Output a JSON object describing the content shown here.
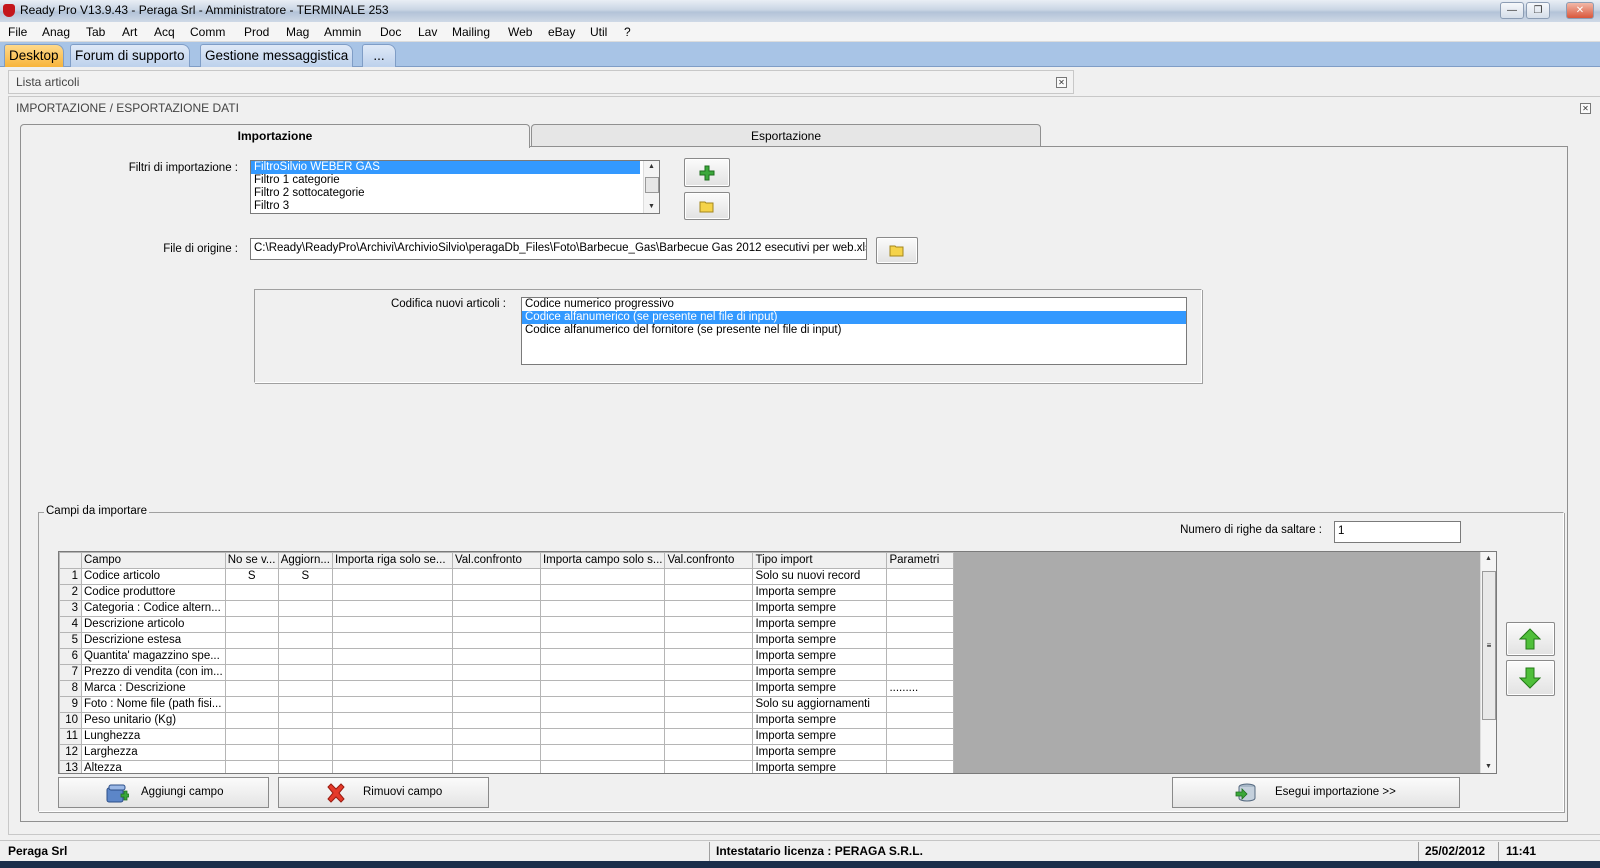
{
  "window": {
    "title": "Ready Pro V13.9.43 - Peraga Srl - Amministratore - TERMINALE 253"
  },
  "menu": [
    "File",
    "Anag",
    "Tab",
    "Art",
    "Acq",
    "Comm",
    "Prod",
    "Mag",
    "Ammin",
    "Doc",
    "Lav",
    "Mailing",
    "Web",
    "eBay",
    "Util",
    "?"
  ],
  "top_tabs": [
    "Desktop",
    "Forum di supporto",
    "Gestione messaggistica",
    "..."
  ],
  "lista_window": {
    "title": "Lista articoli"
  },
  "import_window": {
    "title": "IMPORTAZIONE / ESPORTAZIONE DATI",
    "tabs": [
      "Importazione",
      "Esportazione"
    ],
    "filtri_label": "Filtri di importazione :",
    "filtri": [
      "FiltroSilvio WEBER GAS",
      "Filtro 1 categorie",
      "Filtro 2 sottocategorie",
      "Filtro 3"
    ],
    "filtri_selected": 0,
    "file_label": "File di origine :",
    "file_value": "C:\\Ready\\ReadyPro\\Archivi\\ArchivioSilvio\\peragaDb_Files\\Foto\\Barbecue_Gas\\Barbecue Gas 2012 esecutivi per web.xls",
    "codifica_label": "Codifica nuovi articoli :",
    "codifica": [
      "Codice numerico progressivo",
      "Codice alfanumerico (se presente nel file di input)",
      "Codice alfanumerico del fornitore (se presente nel file di input)"
    ],
    "codifica_selected": 1,
    "campi_label": "Campi da importare",
    "righe_label": "Numero di righe da saltare :",
    "righe_value": "1",
    "columns": [
      "Campo",
      "No se v...",
      "Aggiorn...",
      "Importa riga solo se...",
      "Val.confronto",
      "Importa campo solo s...",
      "Val.confronto",
      "Tipo import",
      "Parametri"
    ],
    "rows": [
      [
        "1",
        "Codice articolo",
        "S",
        "S",
        "",
        "",
        "",
        "",
        "Solo su nuovi record",
        ""
      ],
      [
        "2",
        "Codice produttore",
        "",
        "",
        "",
        "",
        "",
        "",
        "Importa sempre",
        ""
      ],
      [
        "3",
        "Categoria : Codice altern...",
        "",
        "",
        "",
        "",
        "",
        "",
        "Importa sempre",
        ""
      ],
      [
        "4",
        "Descrizione articolo",
        "",
        "",
        "",
        "",
        "",
        "",
        "Importa sempre",
        ""
      ],
      [
        "5",
        "Descrizione estesa",
        "",
        "",
        "",
        "",
        "",
        "",
        "Importa sempre",
        ""
      ],
      [
        "6",
        "Quantita' magazzino spe...",
        "",
        "",
        "",
        "",
        "",
        "",
        "Importa sempre",
        ""
      ],
      [
        "7",
        "Prezzo di vendita (con im...",
        "",
        "",
        "",
        "",
        "",
        "",
        "Importa sempre",
        ""
      ],
      [
        "8",
        "Marca : Descrizione",
        "",
        "",
        "",
        "",
        "",
        "",
        "Importa sempre",
        "........."
      ],
      [
        "9",
        "Foto : Nome file (path fisi...",
        "",
        "",
        "",
        "",
        "",
        "",
        "Solo su aggiornamenti",
        ""
      ],
      [
        "10",
        "Peso unitario (Kg)",
        "",
        "",
        "",
        "",
        "",
        "",
        "Importa sempre",
        ""
      ],
      [
        "11",
        "Lunghezza",
        "",
        "",
        "",
        "",
        "",
        "",
        "Importa sempre",
        ""
      ],
      [
        "12",
        "Larghezza",
        "",
        "",
        "",
        "",
        "",
        "",
        "Importa sempre",
        ""
      ],
      [
        "13",
        "Altezza",
        "",
        "",
        "",
        "",
        "",
        "",
        "Importa sempre",
        ""
      ]
    ],
    "add_label": "Aggiungi campo",
    "remove_label": "Rimuovi campo",
    "run_label": "Esegui importazione >>"
  },
  "status": {
    "company": "Peraga Srl",
    "license": "Intestatario licenza : PERAGA S.R.L.",
    "date": "25/02/2012",
    "time": "11:41"
  },
  "colors": {
    "selection": "#3399ff",
    "tabs_bg": "#a8c4e6",
    "active_tab": "#f7b43b"
  }
}
